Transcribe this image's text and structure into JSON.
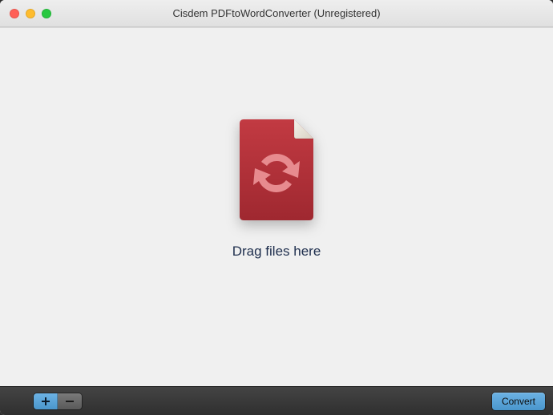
{
  "window": {
    "title": "Cisdem PDFtoWordConverter (Unregistered)"
  },
  "main": {
    "drop_label": "Drag files here"
  },
  "toolbar": {
    "add_label": "+",
    "remove_label": "−",
    "convert_label": "Convert"
  },
  "colors": {
    "file_fill": "#b02c35",
    "file_highlight": "#d96a6f",
    "accent": "#5aa3d6"
  }
}
